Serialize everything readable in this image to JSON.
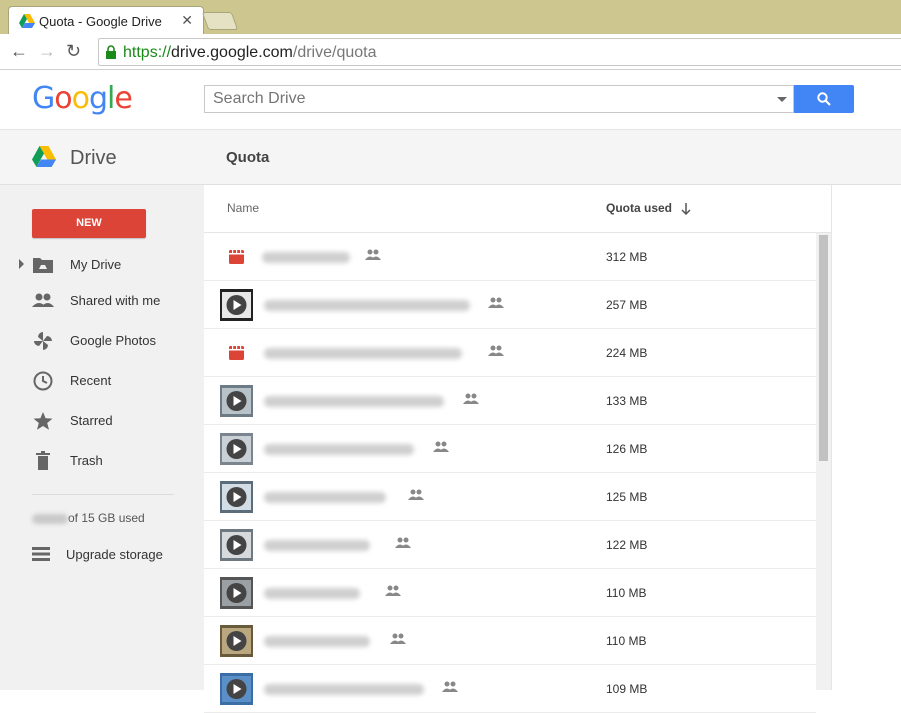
{
  "browser": {
    "tab_title": "Quota - Google Drive",
    "url_scheme": "https://",
    "url_host": "drive.google.com",
    "url_path": "/drive/quota"
  },
  "header": {
    "logo_text": "Google",
    "search_placeholder": "Search Drive",
    "accent_blue": "#4285f4"
  },
  "drive_header": {
    "app_name": "Drive",
    "page_title": "Quota"
  },
  "sidebar": {
    "new_label": "NEW",
    "items": [
      {
        "label": "My Drive",
        "icon": "my-drive-icon"
      },
      {
        "label": "Shared with me",
        "icon": "people-icon"
      },
      {
        "label": "Google Photos",
        "icon": "pinwheel-icon"
      },
      {
        "label": "Recent",
        "icon": "clock-icon"
      },
      {
        "label": "Starred",
        "icon": "star-icon"
      },
      {
        "label": "Trash",
        "icon": "trash-icon"
      }
    ],
    "storage_text": "of 15 GB used",
    "upgrade_label": "Upgrade storage"
  },
  "list": {
    "col_name": "Name",
    "col_quota": "Quota used",
    "rows": [
      {
        "size": "312 MB",
        "thumb": "red-video"
      },
      {
        "size": "257 MB",
        "thumb": "video"
      },
      {
        "size": "224 MB",
        "thumb": "red-video"
      },
      {
        "size": "133 MB",
        "thumb": "video"
      },
      {
        "size": "126 MB",
        "thumb": "video"
      },
      {
        "size": "125 MB",
        "thumb": "video"
      },
      {
        "size": "122 MB",
        "thumb": "video"
      },
      {
        "size": "110 MB",
        "thumb": "video"
      },
      {
        "size": "110 MB",
        "thumb": "video"
      },
      {
        "size": "109 MB",
        "thumb": "video"
      }
    ]
  }
}
